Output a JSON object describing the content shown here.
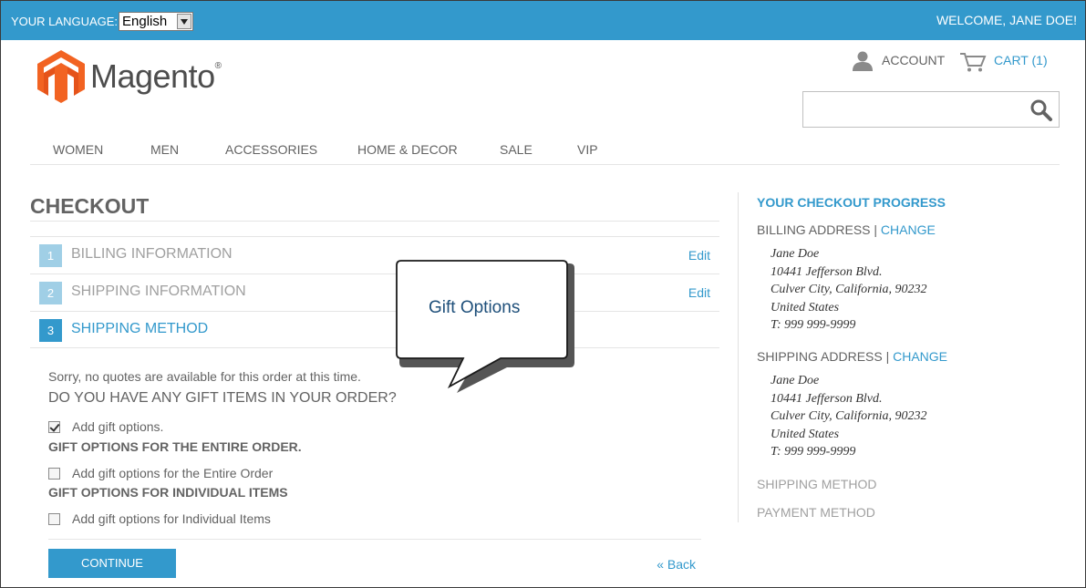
{
  "topbar": {
    "language_label": "YOUR LANGUAGE:",
    "language_value": "English",
    "welcome": "WELCOME, JANE DOE!"
  },
  "header": {
    "logo_text": "Magento",
    "logo_mark": "®",
    "account_label": "ACCOUNT",
    "cart_label": "CART (1)",
    "search_placeholder": ""
  },
  "nav": {
    "items": [
      "WOMEN",
      "MEN",
      "ACCESSORIES",
      "HOME & DECOR",
      "SALE",
      "VIP"
    ]
  },
  "checkout": {
    "title": "CHECKOUT",
    "steps": [
      {
        "num": "1",
        "title": "BILLING INFORMATION",
        "edit": "Edit"
      },
      {
        "num": "2",
        "title": "SHIPPING INFORMATION",
        "edit": "Edit"
      },
      {
        "num": "3",
        "title": "SHIPPING METHOD"
      }
    ],
    "no_quotes": "Sorry, no quotes are available for this order at this time.",
    "gift_question": "DO YOU HAVE ANY GIFT ITEMS IN YOUR ORDER?",
    "add_gift_options": "Add gift options.",
    "entire_order_head": "GIFT OPTIONS FOR THE ENTIRE ORDER.",
    "entire_order_option": "Add gift options for the Entire Order",
    "individual_head": "GIFT OPTIONS FOR INDIVIDUAL ITEMS",
    "individual_option": "Add gift options for Individual Items",
    "continue_label": "CONTINUE",
    "back_label": "« Back"
  },
  "callout": {
    "text": "Gift Options"
  },
  "sidebar": {
    "title": "YOUR CHECKOUT PROGRESS",
    "billing_label": "BILLING ADDRESS",
    "shipping_label": "SHIPPING ADDRESS",
    "separator": " | ",
    "change_label": "CHANGE",
    "billing_address": [
      "Jane Doe",
      "10441 Jefferson Blvd.",
      "Culver City, California, 90232",
      "United States",
      "T: 999 999-9999"
    ],
    "shipping_address": [
      "Jane Doe",
      "10441 Jefferson Blvd.",
      "Culver City, California, 90232",
      "United States",
      "T: 999 999-9999"
    ],
    "shipping_method": "SHIPPING METHOD",
    "payment_method": "PAYMENT METHOD"
  },
  "colors": {
    "accent": "#3399cc",
    "step_inactive": "#a0cfe6",
    "text": "#636363",
    "logo_orange": "#f26322"
  }
}
